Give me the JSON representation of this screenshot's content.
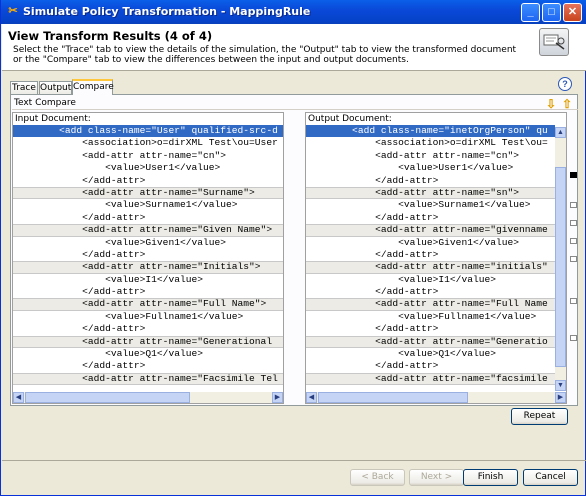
{
  "window": {
    "title": "Simulate Policy Transformation - MappingRule"
  },
  "header": {
    "heading": "View Transform Results (4 of 4)",
    "description": "Select the \"Trace\" tab to view the details of the simulation, the \"Output\" tab to view the transformed document or the \"Compare\" tab to view the differences between the input and output documents."
  },
  "tabs": [
    {
      "label": "Trace"
    },
    {
      "label": "Output"
    },
    {
      "label": "Compare"
    }
  ],
  "compare": {
    "label": "Text Compare",
    "input_label": "Input Document:",
    "output_label": "Output Document:",
    "input_lines": [
      "        <add class-name=\"User\" qualified-src-d",
      "            <association>o=dirXML Test\\ou=User",
      "            <add-attr attr-name=\"cn\">",
      "                <value>User1</value>",
      "            </add-attr>",
      "            <add-attr attr-name=\"Surname\">",
      "                <value>Surname1</value>",
      "            </add-attr>",
      "            <add-attr attr-name=\"Given Name\">",
      "                <value>Given1</value>",
      "            </add-attr>",
      "            <add-attr attr-name=\"Initials\">",
      "                <value>I1</value>",
      "            </add-attr>",
      "            <add-attr attr-name=\"Full Name\">",
      "                <value>Fullname1</value>",
      "            </add-attr>",
      "            <add-attr attr-name=\"Generational",
      "                <value>Q1</value>",
      "            </add-attr>",
      "            <add-attr attr-name=\"Facsimile Tel"
    ],
    "output_lines": [
      "        <add class-name=\"inetOrgPerson\" qu",
      "            <association>o=dirXML Test\\ou=",
      "            <add-attr attr-name=\"cn\">",
      "                <value>User1</value>",
      "            </add-attr>",
      "            <add-attr attr-name=\"sn\">",
      "                <value>Surname1</value>",
      "            </add-attr>",
      "            <add-attr attr-name=\"givenname",
      "                <value>Given1</value>",
      "            </add-attr>",
      "            <add-attr attr-name=\"initials\"",
      "                <value>I1</value>",
      "            </add-attr>",
      "            <add-attr attr-name=\"Full Name",
      "                <value>Fullname1</value>",
      "            </add-attr>",
      "            <add-attr attr-name=\"Generatio",
      "                <value>Q1</value>",
      "            </add-attr>",
      "            <add-attr attr-name=\"facsimile"
    ],
    "diff_rows": [
      0,
      5,
      8,
      11,
      14,
      17,
      20
    ]
  },
  "buttons": {
    "repeat": "Repeat",
    "back": "< Back",
    "next": "Next >",
    "finish": "Finish",
    "cancel": "Cancel"
  }
}
